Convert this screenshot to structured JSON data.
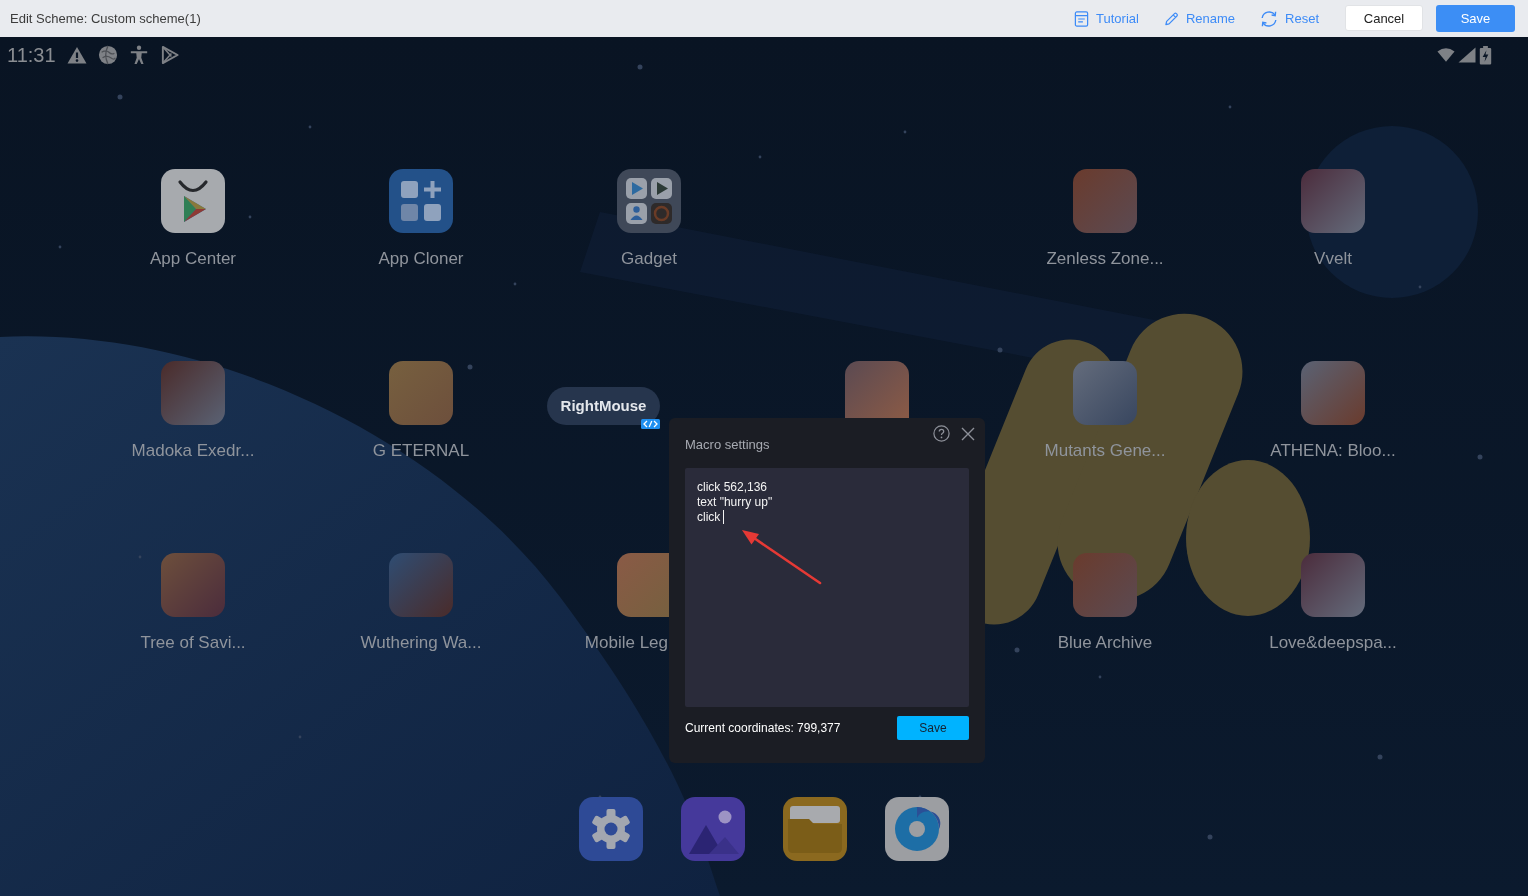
{
  "top_bar": {
    "title": "Edit Scheme: Custom scheme(1)",
    "tutorial_link": {
      "label": "Tutorial"
    },
    "rename_link": {
      "label": "Rename"
    },
    "reset_link": {
      "label": "Reset"
    },
    "cancel_button": {
      "label": "Cancel"
    },
    "save_button": {
      "label": "Save"
    }
  },
  "status_bar": {
    "time": "11:31"
  },
  "home_screen": {
    "rows": [
      [
        {
          "kind": "store",
          "label": "App Center",
          "covered": false
        },
        {
          "kind": "cloner",
          "label": "App Cloner",
          "covered": false
        },
        {
          "kind": "folder",
          "label": "Gadget",
          "covered": false
        },
        {
          "kind": "empty"
        },
        {
          "kind": "game",
          "label": "Zenless Zone...",
          "covered": false
        },
        {
          "kind": "game",
          "label": "Vvelt",
          "covered": false
        }
      ],
      [
        {
          "kind": "game",
          "label": "Madoka Exedr...",
          "covered": false
        },
        {
          "kind": "game",
          "label": "G ETERNAL",
          "covered": false
        },
        {
          "kind": "empty"
        },
        {
          "kind": "game",
          "covered": true
        },
        {
          "kind": "game",
          "label": "Mutants Gene...",
          "covered": false
        },
        {
          "kind": "game",
          "label": "ATHENA: Bloo...",
          "covered": false
        }
      ],
      [
        {
          "kind": "game",
          "label": "Tree of Savi...",
          "covered": false
        },
        {
          "kind": "game",
          "label": "Wuthering Wa...",
          "covered": false
        },
        {
          "kind": "game",
          "label": "Mobile Leg",
          "covered": true
        },
        {
          "kind": "empty"
        },
        {
          "kind": "game",
          "label": "Blue Archive",
          "covered": false
        },
        {
          "kind": "game",
          "label": "Love&deepspa...",
          "covered": false
        }
      ]
    ]
  },
  "key_mapping": {
    "label": "RightMouse"
  },
  "macro_dialog": {
    "title": "Macro settings",
    "editor": {
      "value": "click 562,136\ntext \"hurry up\"\nclick",
      "focused": true
    },
    "coordinates": "Current coordinates: 799,377",
    "save_button": {
      "label": "Save"
    }
  }
}
